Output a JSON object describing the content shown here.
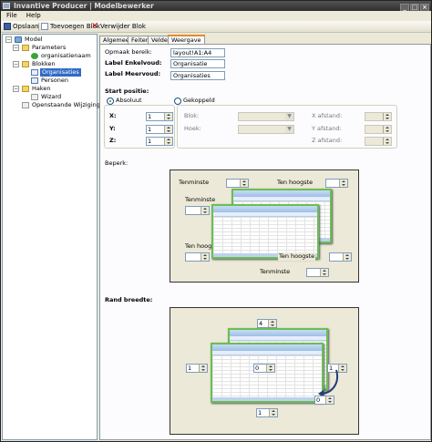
{
  "window": {
    "title": "Invantive Producer | Modelbewerker"
  },
  "menu": {
    "file": "File",
    "help": "Help"
  },
  "toolbar": {
    "save": "Opslaan",
    "add_block": "Toevoegen Blok",
    "delete_block": "Verwijder Blok"
  },
  "tree": {
    "model": "Model",
    "parameters": "Parameters",
    "param_item": "organisatienaam",
    "blocks": "Blokken",
    "block1": "Organisaties",
    "block2": "Personen",
    "hooks": "Haken",
    "hook1": "Wizard",
    "pending": "Openstaande Wijziging"
  },
  "tabs": {
    "general": "Algemeen",
    "facts": "Feiten",
    "fields": "Velden",
    "display": "Weergave"
  },
  "form": {
    "range_label": "Opmaak bereik:",
    "range_value": "layout!A1:A4",
    "singular_label": "Label Enkelvoud:",
    "singular_value": "Organisatie",
    "plural_label": "Label Meervoud:",
    "plural_value": "Organisaties",
    "start_label": "Start positie:",
    "absolute": "Absoluut",
    "linked": "Gekoppeld",
    "x_label": "X:",
    "x_value": "1",
    "y_label": "Y:",
    "y_value": "1",
    "z_label": "Z:",
    "z_value": "1",
    "block_label": "Blok:",
    "corner_label": "Hoek:",
    "xdist_label": "X afstand:",
    "ydist_label": "Y afstand:",
    "zdist_label": "Z afstand:",
    "limit_label": "Beperk:",
    "min_label": "Tenminste",
    "max_label": "Ten hoogste",
    "border_label": "Rand breedte:",
    "border_top": "4",
    "border_left": "1",
    "border_inner": "0",
    "border_right": "1",
    "border_depth": "0",
    "border_bottom": "1"
  }
}
